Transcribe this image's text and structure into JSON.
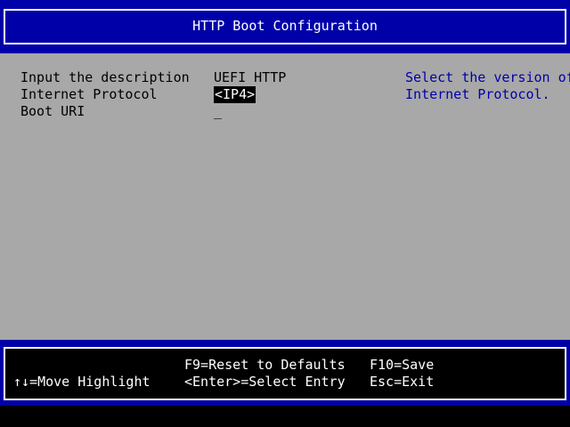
{
  "header": {
    "title": "HTTP Boot Configuration"
  },
  "form": {
    "rows": [
      {
        "label": "Input the description",
        "value": "UEFI HTTP"
      },
      {
        "label": "Internet Protocol",
        "value": "<IP4>"
      },
      {
        "label": "Boot URI",
        "value": "_"
      }
    ]
  },
  "help": {
    "lines": [
      "Select the version of",
      "Internet Protocol."
    ]
  },
  "footer": {
    "move_highlight": "↑↓=Move Highlight",
    "reset_defaults": "F9=Reset to Defaults",
    "select_entry": "<Enter>=Select Entry",
    "save": "F10=Save",
    "exit": "Esc=Exit"
  },
  "colors": {
    "title_bar": "#0000a8",
    "background": "#a8a8a8",
    "help_text": "#0000a8",
    "footer_background": "#000000",
    "highlight": "#000000"
  }
}
